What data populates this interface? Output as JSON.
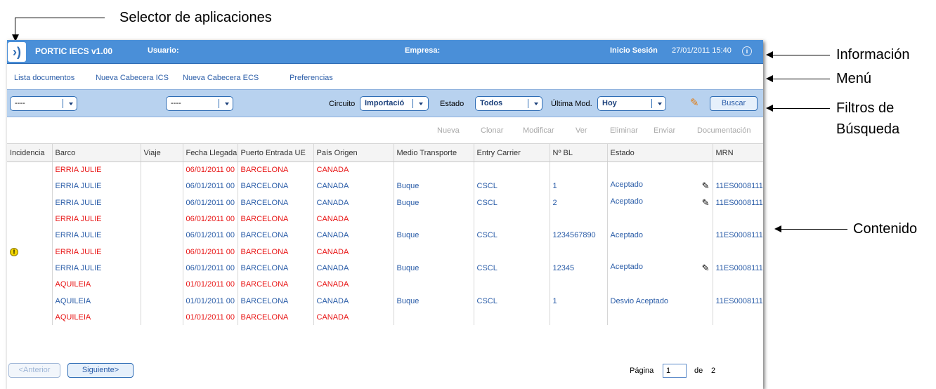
{
  "annotations": {
    "selector": "Selector de aplicaciones",
    "info": "Información",
    "menu": "Menú",
    "filters_line1": "Filtros de",
    "filters_line2": "Búsqueda",
    "content": "Contenido"
  },
  "header": {
    "logo": "›)",
    "app_title": "PORTIC IECS v1.00",
    "user_label": "Usuario:",
    "company_label": "Empresa:",
    "session_label": "Inicio Sesión",
    "session_time": "27/01/2011 15:40",
    "info_icon": "i"
  },
  "menu": {
    "items": [
      "Lista documentos",
      "Nueva Cabecera ICS",
      "Nueva Cabecera ECS",
      "Preferencias"
    ]
  },
  "filters": {
    "select1": "----",
    "select2": "----",
    "circuito_label": "Circuito",
    "circuito_value": "Importació",
    "estado_label": "Estado",
    "estado_value": "Todos",
    "ultima_label": "Última Mod.",
    "ultima_value": "Hoy",
    "search_button": "Buscar"
  },
  "actions": [
    "Nueva",
    "Clonar",
    "Modificar",
    "Ver",
    "Eliminar",
    "Enviar",
    "Documentación"
  ],
  "table": {
    "headers": [
      "Incidencia",
      "Barco",
      "Viaje",
      "Fecha Llegada",
      "Puerto Entrada UE",
      "País Origen",
      "Medio Transporte",
      "Entry Carrier",
      "Nº BL",
      "Estado",
      "MRN"
    ],
    "rows": [
      {
        "incidencia": "",
        "barco": "ERRIA JULIE",
        "viaje": "",
        "fecha": "06/01/2011 00",
        "puerto": "BARCELONA",
        "pais": "CANADA",
        "medio": "",
        "carrier": "",
        "bl": "",
        "estado": "",
        "mrn": "",
        "red": true,
        "edit": false
      },
      {
        "incidencia": "",
        "barco": "ERRIA JULIE",
        "viaje": "",
        "fecha": "06/01/2011 00",
        "puerto": "BARCELONA",
        "pais": "CANADA",
        "medio": "Buque",
        "carrier": "CSCL",
        "bl": "1",
        "estado": "Aceptado",
        "mrn": "11ES0008111",
        "red": false,
        "edit": true
      },
      {
        "incidencia": "",
        "barco": "ERRIA JULIE",
        "viaje": "",
        "fecha": "06/01/2011 00",
        "puerto": "BARCELONA",
        "pais": "CANADA",
        "medio": "Buque",
        "carrier": "CSCL",
        "bl": "2",
        "estado": "Aceptado",
        "mrn": "11ES0008111",
        "red": false,
        "edit": true
      },
      {
        "incidencia": "",
        "barco": "ERRIA JULIE",
        "viaje": "",
        "fecha": "06/01/2011 00",
        "puerto": "BARCELONA",
        "pais": "CANADA",
        "medio": "",
        "carrier": "",
        "bl": "",
        "estado": "",
        "mrn": "",
        "red": true,
        "edit": false
      },
      {
        "incidencia": "",
        "barco": "ERRIA JULIE",
        "viaje": "",
        "fecha": "06/01/2011 00",
        "puerto": "BARCELONA",
        "pais": "CANADA",
        "medio": "Buque",
        "carrier": "CSCL",
        "bl": "1234567890",
        "estado": "Aceptado",
        "mrn": "11ES0008111",
        "red": false,
        "edit": false
      },
      {
        "incidencia": "!",
        "barco": "ERRIA JULIE",
        "viaje": "",
        "fecha": "06/01/2011 00",
        "puerto": "BARCELONA",
        "pais": "CANADA",
        "medio": "",
        "carrier": "",
        "bl": "",
        "estado": "",
        "mrn": "",
        "red": true,
        "edit": false
      },
      {
        "incidencia": "",
        "barco": "ERRIA JULIE",
        "viaje": "",
        "fecha": "06/01/2011 00",
        "puerto": "BARCELONA",
        "pais": "CANADA",
        "medio": "Buque",
        "carrier": "CSCL",
        "bl": "12345",
        "estado": "Aceptado",
        "mrn": "11ES0008111",
        "red": false,
        "edit": true
      },
      {
        "incidencia": "",
        "barco": "AQUILEIA",
        "viaje": "",
        "fecha": "01/01/2011 00",
        "puerto": "BARCELONA",
        "pais": "CANADA",
        "medio": "",
        "carrier": "",
        "bl": "",
        "estado": "",
        "mrn": "",
        "red": true,
        "edit": false
      },
      {
        "incidencia": "",
        "barco": "AQUILEIA",
        "viaje": "",
        "fecha": "01/01/2011 00",
        "puerto": "BARCELONA",
        "pais": "CANADA",
        "medio": "Buque",
        "carrier": "CSCL",
        "bl": "1",
        "estado": "Desvio Aceptado",
        "mrn": "11ES0008111",
        "red": false,
        "edit": false
      },
      {
        "incidencia": "",
        "barco": "AQUILEIA",
        "viaje": "",
        "fecha": "01/01/2011 00",
        "puerto": "BARCELONA",
        "pais": "CANADA",
        "medio": "",
        "carrier": "",
        "bl": "",
        "estado": "",
        "mrn": "",
        "red": true,
        "edit": false
      }
    ]
  },
  "pagination": {
    "prev": "<Anterior",
    "next": "Siguiente>",
    "page_label": "Página",
    "page_value": "1",
    "of_label": "de",
    "total": "2"
  },
  "colors": {
    "header_blue": "#4a8fd8",
    "filter_bg": "#b8d2ef",
    "link_blue": "#2b5da8",
    "alert_red": "#e81414"
  }
}
